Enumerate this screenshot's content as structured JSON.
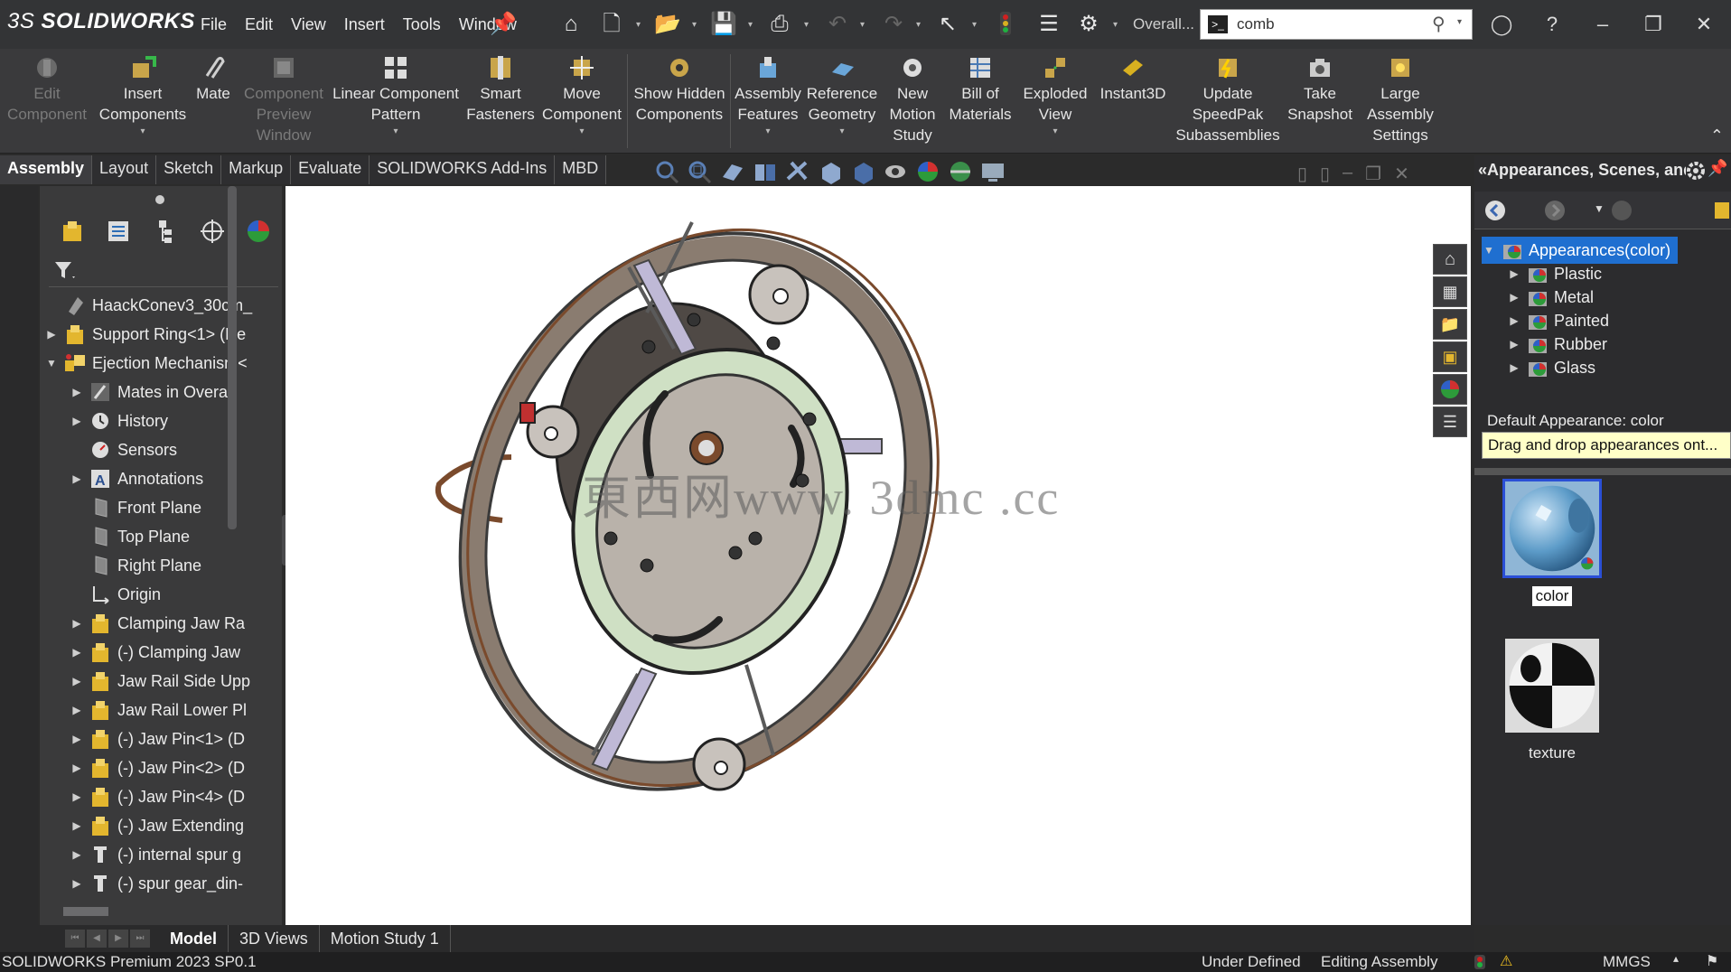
{
  "app": {
    "logo_prefix": "3S",
    "logo_name": "SOLIDWORKS",
    "overall_label": "Overall..."
  },
  "menu": [
    "File",
    "Edit",
    "View",
    "Insert",
    "Tools",
    "Window"
  ],
  "search": {
    "value": "comb"
  },
  "ribbon": {
    "buttons": [
      {
        "label": "Edit Component",
        "disabled": true
      },
      {
        "label": "Insert Components",
        "disabled": false
      },
      {
        "label": "Mate",
        "disabled": false
      },
      {
        "label": "Component Preview Window",
        "disabled": true
      },
      {
        "label": "Linear Component Pattern",
        "disabled": false
      },
      {
        "label": "Smart Fasteners",
        "disabled": false
      },
      {
        "label": "Move Component",
        "disabled": false
      },
      {
        "label": "Show Hidden Components",
        "disabled": false
      },
      {
        "label": "Assembly Features",
        "disabled": false
      },
      {
        "label": "Reference Geometry",
        "disabled": false
      },
      {
        "label": "New Motion Study",
        "disabled": false
      },
      {
        "label": "Bill of Materials",
        "disabled": false
      },
      {
        "label": "Exploded View",
        "disabled": false
      },
      {
        "label": "Instant3D",
        "disabled": false
      },
      {
        "label": "Update SpeedPak Subassemblies",
        "disabled": false
      },
      {
        "label": "Take Snapshot",
        "disabled": false
      },
      {
        "label": "Large Assembly Settings",
        "disabled": false
      }
    ]
  },
  "tabs": [
    "Assembly",
    "Layout",
    "Sketch",
    "Markup",
    "Evaluate",
    "SOLIDWORKS Add-Ins",
    "MBD"
  ],
  "feature_tree": [
    {
      "label": "HaackConev3_30cm_",
      "level": 0,
      "arrow": "",
      "icon": "part"
    },
    {
      "label": "Support Ring<1> (De",
      "level": 0,
      "arrow": "right",
      "icon": "component"
    },
    {
      "label": "Ejection Mechanism<",
      "level": 0,
      "arrow": "down",
      "icon": "subassembly"
    },
    {
      "label": "Mates in Overall",
      "level": 1,
      "arrow": "right",
      "icon": "mates"
    },
    {
      "label": "History",
      "level": 1,
      "arrow": "right",
      "icon": "history"
    },
    {
      "label": "Sensors",
      "level": 1,
      "arrow": "",
      "icon": "sensors"
    },
    {
      "label": "Annotations",
      "level": 1,
      "arrow": "right",
      "icon": "annotations"
    },
    {
      "label": "Front Plane",
      "level": 1,
      "arrow": "",
      "icon": "plane"
    },
    {
      "label": "Top Plane",
      "level": 1,
      "arrow": "",
      "icon": "plane"
    },
    {
      "label": "Right Plane",
      "level": 1,
      "arrow": "",
      "icon": "plane"
    },
    {
      "label": "Origin",
      "level": 1,
      "arrow": "",
      "icon": "origin"
    },
    {
      "label": "Clamping Jaw Ra",
      "level": 1,
      "arrow": "right",
      "icon": "component"
    },
    {
      "label": "(-) Clamping Jaw",
      "level": 1,
      "arrow": "right",
      "icon": "component"
    },
    {
      "label": "Jaw Rail Side Upp",
      "level": 1,
      "arrow": "right",
      "icon": "component"
    },
    {
      "label": "Jaw Rail Lower Pl",
      "level": 1,
      "arrow": "right",
      "icon": "component"
    },
    {
      "label": "(-) Jaw Pin<1> (D",
      "level": 1,
      "arrow": "right",
      "icon": "component"
    },
    {
      "label": "(-) Jaw Pin<2> (D",
      "level": 1,
      "arrow": "right",
      "icon": "component"
    },
    {
      "label": "(-) Jaw Pin<4> (D",
      "level": 1,
      "arrow": "right",
      "icon": "component"
    },
    {
      "label": "(-) Jaw Extending",
      "level": 1,
      "arrow": "right",
      "icon": "component"
    },
    {
      "label": "(-) internal spur g",
      "level": 1,
      "arrow": "right",
      "icon": "toolbox"
    },
    {
      "label": "(-) spur gear_din-",
      "level": 1,
      "arrow": "right",
      "icon": "toolbox"
    }
  ],
  "viewport": {
    "watermark": "東西网www. 3dmc   .cc"
  },
  "right_panel": {
    "title": "Appearances, Scenes, and",
    "tree": [
      {
        "label": "Appearances(color)",
        "level": 0,
        "arrow": "down",
        "selected": true
      },
      {
        "label": "Plastic",
        "level": 1,
        "arrow": "right",
        "selected": false
      },
      {
        "label": "Metal",
        "level": 1,
        "arrow": "right",
        "selected": false
      },
      {
        "label": "Painted",
        "level": 1,
        "arrow": "right",
        "selected": false
      },
      {
        "label": "Rubber",
        "level": 1,
        "arrow": "right",
        "selected": false
      },
      {
        "label": "Glass",
        "level": 1,
        "arrow": "right",
        "selected": false
      }
    ],
    "default_appearance": "Default Appearance: color",
    "tooltip": "Drag and drop appearances ont...",
    "swatches": [
      {
        "label": "color",
        "selected": true
      },
      {
        "label": "texture",
        "selected": false
      }
    ]
  },
  "bottom_tabs": [
    "Model",
    "3D Views",
    "Motion Study 1"
  ],
  "status": {
    "product": "SOLIDWORKS Premium 2023 SP0.1",
    "defined": "Under Defined",
    "mode": "Editing Assembly",
    "units": "MMGS"
  },
  "colors": {
    "selection": "#1f6fd0",
    "tooltip_bg": "#ffffc8",
    "plate": "#b9b2aa",
    "ring_green": "#cfe0c4",
    "copper": "#7a4a2c"
  }
}
